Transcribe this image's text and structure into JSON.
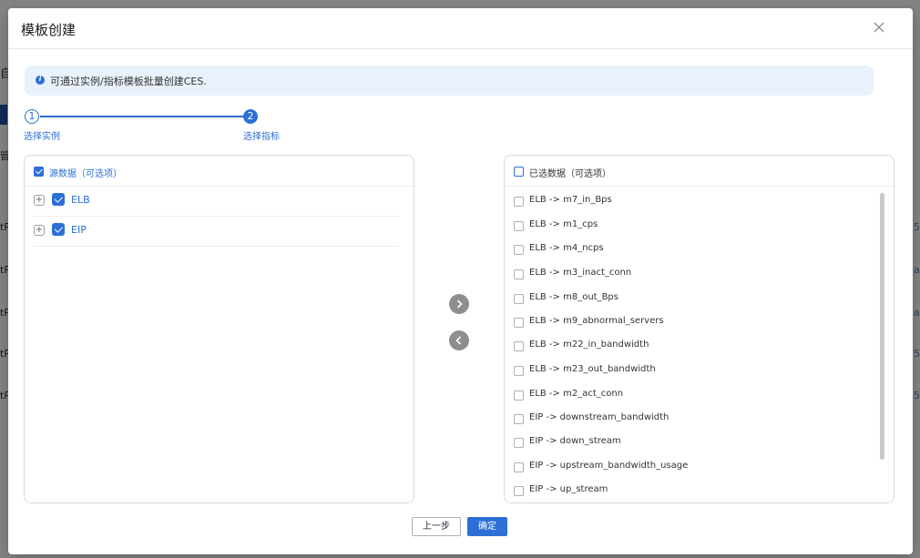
{
  "background": {
    "fragments": [
      "自",
      "管",
      "tP",
      "tP",
      "tP",
      "tP",
      "tP"
    ],
    "right_links": [
      "5",
      "a",
      "a",
      "5",
      "5"
    ]
  },
  "dialog": {
    "title": "模板创建",
    "info_text": "可通过实例/指标模板批量创建CES.",
    "steps": [
      {
        "number": "1",
        "label": "选择实例"
      },
      {
        "number": "2",
        "label": "选择指标"
      }
    ],
    "source_panel": {
      "header": "源数据（可选项）",
      "header_checked": true,
      "tree": [
        {
          "label": "ELB",
          "checked": true,
          "expand": "+"
        },
        {
          "label": "EIP",
          "checked": true,
          "expand": "+"
        }
      ]
    },
    "target_panel": {
      "header": "已选数据（可选项）",
      "header_checked": false,
      "items": [
        "ELB -> m7_in_Bps",
        "ELB -> m1_cps",
        "ELB -> m4_ncps",
        "ELB -> m3_inact_conn",
        "ELB -> m8_out_Bps",
        "ELB -> m9_abnormal_servers",
        "ELB -> m22_in_bandwidth",
        "ELB -> m23_out_bandwidth",
        "ELB -> m2_act_conn",
        "EIP -> downstream_bandwidth",
        "EIP -> down_stream",
        "EIP -> upstream_bandwidth_usage",
        "EIP -> up_stream"
      ]
    },
    "buttons": {
      "prev": "上一步",
      "confirm": "确定"
    },
    "icons": {
      "close": "close-icon",
      "move_right": "chevron-right-icon",
      "move_left": "chevron-left-icon",
      "info": "info-icon"
    },
    "colors": {
      "accent": "#2c6fd6",
      "info_bg": "#e9f1fc"
    }
  }
}
